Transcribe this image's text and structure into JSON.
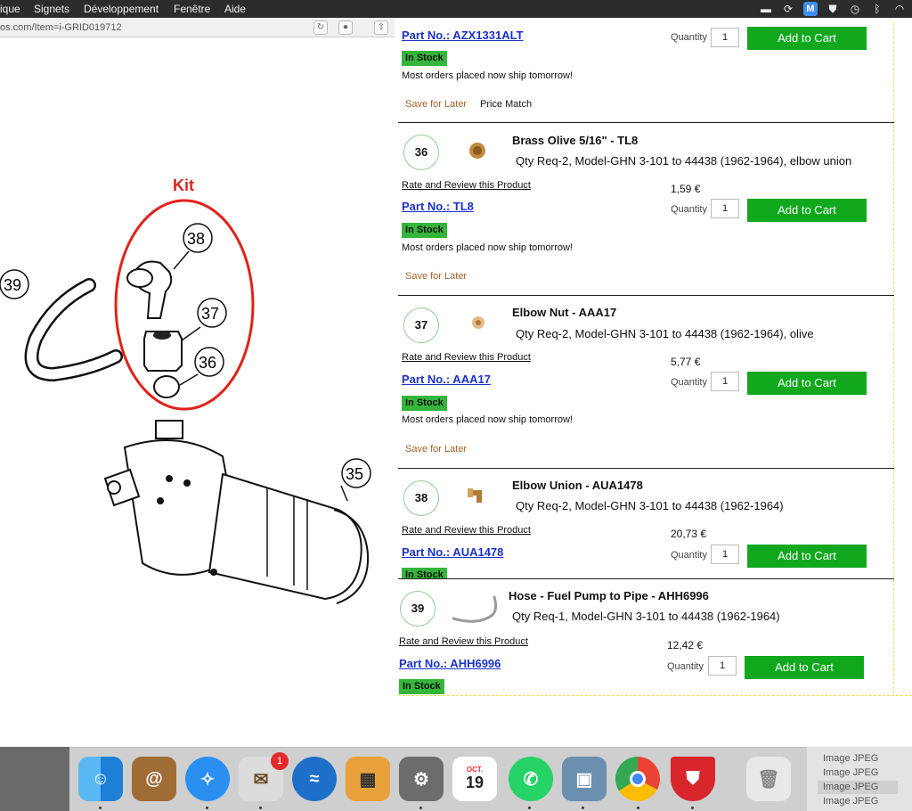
{
  "menubar": {
    "items": [
      "ique",
      "Signets",
      "Développement",
      "Fenêtre",
      "Aide"
    ]
  },
  "browser": {
    "url": "os.com/Item=i-GRID019712"
  },
  "diagram": {
    "kit_label": "Kit",
    "callouts": [
      "38",
      "37",
      "36",
      "39",
      "35"
    ]
  },
  "products": [
    {
      "title": "",
      "part_no": "Part No.: AZX1331ALT",
      "qty_label": "Quantity",
      "qty_value": "1",
      "cart_label": "Add to Cart",
      "stock": "In Stock",
      "ship": "Most orders placed now ship tomorrow!",
      "save": "Save for Later",
      "price_match": "Price Match"
    },
    {
      "num": "36",
      "title": "Brass Olive 5/16\" - TL8",
      "qty_req": "Qty Req-2, Model-GHN 3-101 to 44438 (1962-1964), elbow union",
      "rate": "Rate and Review this Product",
      "price": "1,59 €",
      "part_no": "Part No.: TL8",
      "qty_label": "Quantity",
      "qty_value": "1",
      "cart_label": "Add to Cart",
      "stock": "In Stock",
      "ship": "Most orders placed now ship tomorrow!",
      "save": "Save for Later"
    },
    {
      "num": "37",
      "title": "Elbow Nut - AAA17",
      "qty_req": "Qty Req-2, Model-GHN 3-101 to 44438 (1962-1964), olive",
      "rate": "Rate and Review this Product",
      "price": "5,77 €",
      "part_no": "Part No.: AAA17",
      "qty_label": "Quantity",
      "qty_value": "1",
      "cart_label": "Add to Cart",
      "stock": "In Stock",
      "ship": "Most orders placed now ship tomorrow!",
      "save": "Save for Later"
    },
    {
      "num": "38",
      "title": "Elbow Union - AUA1478",
      "qty_req": "Qty Req-2, Model-GHN 3-101 to 44438 (1962-1964)",
      "rate": "Rate and Review this Product",
      "price": "20,73 €",
      "part_no": "Part No.: AUA1478",
      "qty_label": "Quantity",
      "qty_value": "1",
      "cart_label": "Add to Cart",
      "stock": "In Stock"
    },
    {
      "num": "39",
      "title": "Hose - Fuel Pump to Pipe - AHH6996",
      "qty_req": "Qty Req-1, Model-GHN 3-101 to 44438 (1962-1964)",
      "rate": "Rate and Review this Product",
      "price": "12,42 €",
      "part_no": "Part No.: AHH6996",
      "qty_label": "Quantity",
      "qty_value": "1",
      "cart_label": "Add to Cart",
      "stock": "In Stock"
    }
  ],
  "dock": {
    "badge": "1",
    "calendar_month": "OCT.",
    "calendar_day": "19",
    "apps": [
      "finder-icon",
      "contacts-icon",
      "safari-icon",
      "mail-icon",
      "openoffice-icon",
      "calculator-icon",
      "system-preferences-icon",
      "calendar-icon",
      "whatsapp-icon",
      "preview-icon",
      "chrome-icon",
      "shield-app-icon",
      "trash-icon"
    ]
  },
  "stack": {
    "items": [
      "Image JPEG",
      "Image JPEG",
      "Image JPEG",
      "Image JPEG"
    ]
  }
}
